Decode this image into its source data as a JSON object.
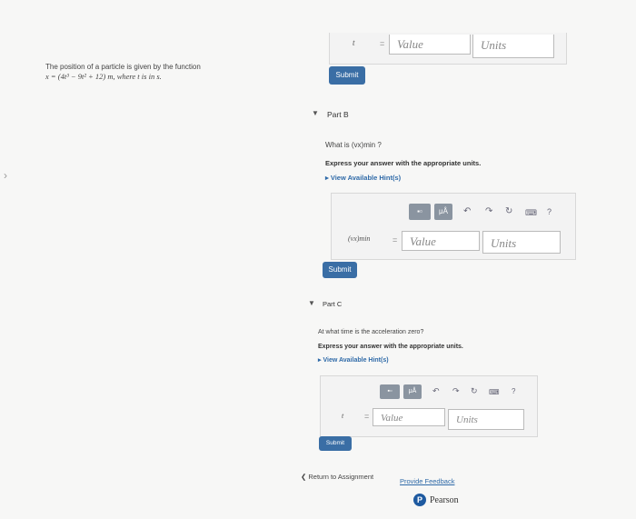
{
  "problem": {
    "text": "The position of a particle is given by the function",
    "equation": "x = (4t³ − 9t² + 12) m, where t is in s."
  },
  "part_a": {
    "var_label": "t",
    "equals": "=",
    "value_placeholder": "Value",
    "units_placeholder": "Units",
    "submit": "Submit"
  },
  "part_b": {
    "title": "Part B",
    "question": "What is (vx)min ?",
    "instruction": "Express your answer with the appropriate units.",
    "hints": "View Available Hint(s)",
    "var_label": "(vx)min",
    "equals": "=",
    "value_placeholder": "Value",
    "units_placeholder": "Units",
    "submit": "Submit",
    "toolbar": {
      "matrix": "▪▫",
      "mu": "μÅ",
      "help": "?"
    }
  },
  "part_c": {
    "title": "Part C",
    "question": "At what time is the acceleration zero?",
    "instruction": "Express your answer with the appropriate units.",
    "hints": "View Available Hint(s)",
    "var_label": "t",
    "equals": "=",
    "value_placeholder": "Value",
    "units_placeholder": "Units",
    "submit": "Submit",
    "toolbar": {
      "matrix": "▪▫",
      "mu": "μÅ",
      "help": "?"
    }
  },
  "footer": {
    "return": "Return to Assignment",
    "feedback": "Provide Feedback",
    "brand": "Pearson",
    "brand_letter": "P"
  },
  "icons": [
    "chevron-left-icon",
    "undo-icon",
    "redo-icon",
    "reset-icon",
    "keyboard-icon",
    "help-icon",
    "caret-down-icon",
    "caret-right-icon"
  ],
  "colors": {
    "submit": "#3a6ea5",
    "link": "#2f6aa8",
    "brand": "#1e5aa0"
  }
}
